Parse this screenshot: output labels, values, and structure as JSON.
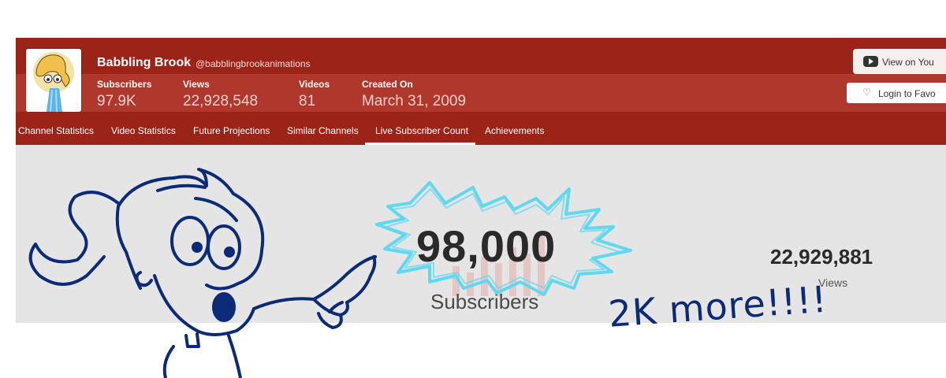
{
  "channel": {
    "name": "Babbling Brook",
    "handle": "@babblingbrookanimations"
  },
  "stats": [
    {
      "label": "Subscribers",
      "value": "97.9K"
    },
    {
      "label": "Views",
      "value": "22,928,548"
    },
    {
      "label": "Videos",
      "value": "81"
    },
    {
      "label": "Created On",
      "value": "March 31, 2009"
    }
  ],
  "buttons": {
    "view_on_youtube": "View on You",
    "login_to_favorite": "Login to Favo"
  },
  "tabs": [
    {
      "label": "Channel Statistics",
      "active": false
    },
    {
      "label": "Video Statistics",
      "active": false
    },
    {
      "label": "Future Projections",
      "active": false
    },
    {
      "label": "Similar Channels",
      "active": false
    },
    {
      "label": "Live Subscriber Count",
      "active": true
    },
    {
      "label": "Achievements",
      "active": false
    }
  ],
  "live": {
    "subscribers_value": "98,000",
    "subscribers_label": "Subscribers",
    "views_value": "22,929,881",
    "views_label": "Views"
  },
  "doodle": {
    "handwritten_text": "2K more!!!!",
    "starburst_color": "#5fd8f0",
    "ink_color": "#0b2a78"
  },
  "colors": {
    "brand_dark": "#9b2318",
    "brand_light": "#b0372c",
    "content_bg": "#e5e5e5"
  },
  "icons": [
    "youtube-icon",
    "heart-icon"
  ]
}
